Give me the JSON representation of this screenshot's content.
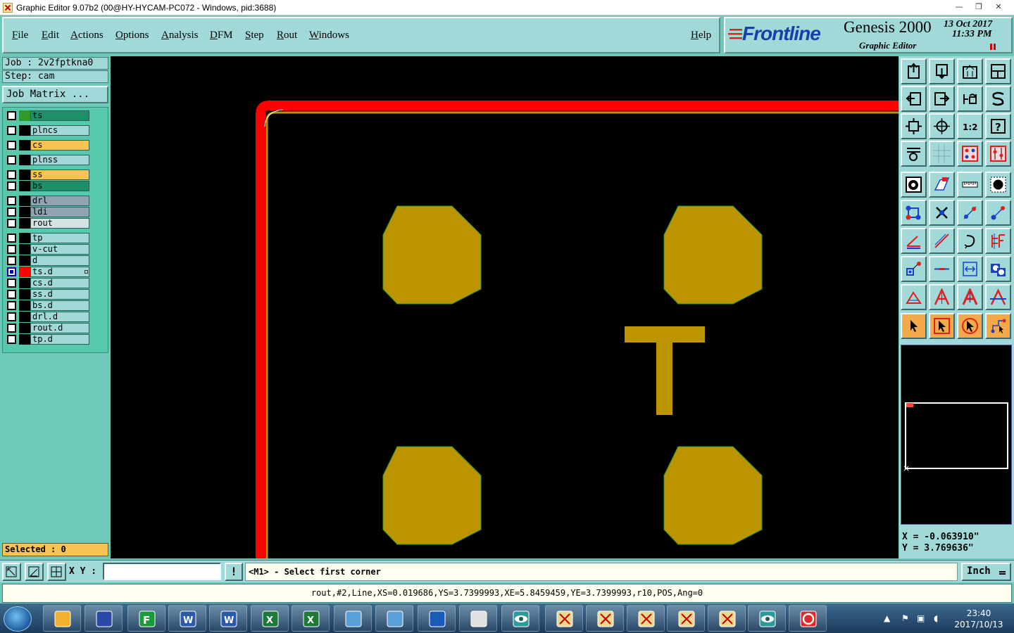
{
  "window": {
    "title": "Graphic Editor 9.07b2 (00@HY-HYCAM-PC072 - Windows, pid:3688)",
    "controls": [
      "—",
      "❐",
      "✕"
    ]
  },
  "menu": {
    "items": [
      "File",
      "Edit",
      "Actions",
      "Options",
      "Analysis",
      "DFM",
      "Step",
      "Rout",
      "Windows"
    ],
    "help": "Help"
  },
  "brand": {
    "logo": "Frontline",
    "product": "Genesis 2000",
    "module": "Graphic Editor",
    "date": "13 Oct 2017",
    "time": "11:33 PM"
  },
  "job": {
    "job_label": "Job : 2v2fptkna0",
    "step_label": "Step: cam",
    "matrix_button": "Job Matrix ..."
  },
  "layers": [
    {
      "name": "ts",
      "color": "#1f8f6a",
      "swatch": "#2f9a2a",
      "active": false
    },
    {
      "name": "plncs",
      "color": "#a1d8d8",
      "swatch": "#000000",
      "active": false
    },
    {
      "name": "cs",
      "color": "#f9c353",
      "swatch": "#000000",
      "active": false
    },
    {
      "name": "plnss",
      "color": "#a1d8d8",
      "swatch": "#000000",
      "active": false
    },
    {
      "name": "ss",
      "color": "#f9c353",
      "swatch": "#000000",
      "active": false
    },
    {
      "name": "bs",
      "color": "#1f8f6a",
      "swatch": "#000000",
      "active": false
    },
    {
      "name": "drl",
      "color": "#8fa3b0",
      "swatch": "#000000",
      "active": false
    },
    {
      "name": "ldi",
      "color": "#8fa3b0",
      "swatch": "#000000",
      "active": false
    },
    {
      "name": "rout",
      "color": "#d6e2e2",
      "swatch": "#000000",
      "active": false
    },
    {
      "name": "tp",
      "color": "#a1d8d8",
      "swatch": "#000000",
      "active": false
    },
    {
      "name": "v-cut",
      "color": "#a1d8d8",
      "swatch": "#000000",
      "active": false
    },
    {
      "name": "d",
      "color": "#a1d8d8",
      "swatch": "#000000",
      "active": false
    },
    {
      "name": "ts.d",
      "color": "#a1d8d8",
      "swatch": "#ff0000",
      "active": true
    },
    {
      "name": "cs.d",
      "color": "#a1d8d8",
      "swatch": "#000000",
      "active": false
    },
    {
      "name": "ss.d",
      "color": "#a1d8d8",
      "swatch": "#000000",
      "active": false
    },
    {
      "name": "bs.d",
      "color": "#a1d8d8",
      "swatch": "#000000",
      "active": false
    },
    {
      "name": "drl.d",
      "color": "#a1d8d8",
      "swatch": "#000000",
      "active": false
    },
    {
      "name": "rout.d",
      "color": "#a1d8d8",
      "swatch": "#000000",
      "active": false
    },
    {
      "name": "tp.d",
      "color": "#a1d8d8",
      "swatch": "#000000",
      "active": false
    }
  ],
  "selected": "Selected : 0",
  "coords": {
    "x": "X = -0.063910\"",
    "y": "Y = 3.769636\""
  },
  "colors": {
    "canvas": "#000000",
    "pad": "#bb9400",
    "rout_line": "#ff0000",
    "panel": "#a1d8d8",
    "layer_panel": "#56c8ac"
  },
  "bottom": {
    "xy_label": "X Y :",
    "xy_value": "",
    "warn": "!",
    "prompt": "<M1> - Select first corner",
    "unit": "Inch"
  },
  "status": "rout,#2,Line,XS=0.019686,YS=3.7399993,XE=5.8459459,YE=3.7399993,r10,POS,Ang=0",
  "taskbar": {
    "clock_time": "23:40",
    "clock_date": "2017/10/13",
    "apps": [
      "file-manager",
      "save",
      "frontline-f",
      "word",
      "word",
      "excel",
      "excel",
      "image-viewer",
      "image-viewer",
      "frontline-genesis",
      "document",
      "eye-app",
      "graphic-editor",
      "graphic-editor",
      "graphic-editor",
      "graphic-editor",
      "graphic-editor",
      "eye-app",
      "genesis-g"
    ]
  },
  "toolbar_icons": [
    [
      "zoom-home-icon",
      "zoom-down-icon",
      "zoom-window-icon",
      "zoom-region-icon"
    ],
    [
      "pan-left-icon",
      "pan-right-icon",
      "undo-view-icon",
      "redraw-icon"
    ],
    [
      "fit-all-icon",
      "fit-center-icon",
      "scale-1-2-icon",
      "help-query-icon"
    ],
    [
      "snap-settings-icon",
      "grid-icon",
      "layer-toggle-icon",
      "layer-toggle-red-icon"
    ],
    [
      "pad-select-icon",
      "polygon-icon",
      "ruler-icon",
      "dot-icon"
    ],
    [
      "net-icon",
      "cross-icon",
      "line-node-icon",
      "line-node2-icon"
    ],
    [
      "angle-icon",
      "line-draw-icon",
      "arc-icon",
      "compare-icon"
    ],
    [
      "move-pad-icon",
      "dash-icon",
      "measure-icon",
      "shapes-icon"
    ],
    [
      "text-small-icon",
      "text-a-icon",
      "text-a-red-icon",
      "text-a-line-icon"
    ],
    [
      "pointer-icon",
      "pointer-box-icon",
      "pointer-round-icon",
      "pointer-net-icon"
    ]
  ]
}
